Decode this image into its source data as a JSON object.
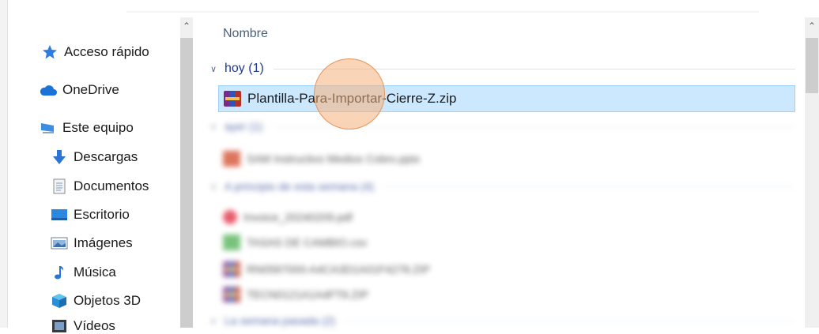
{
  "nav": {
    "items": [
      {
        "label": "Acceso rápido",
        "icon": "star-icon"
      },
      {
        "label": "OneDrive",
        "icon": "cloud-icon"
      },
      {
        "label": "Este equipo",
        "icon": "computer-icon"
      },
      {
        "label": "Descargas",
        "icon": "download-arrow-icon"
      },
      {
        "label": "Documentos",
        "icon": "document-icon"
      },
      {
        "label": "Escritorio",
        "icon": "desktop-icon"
      },
      {
        "label": "Imágenes",
        "icon": "pictures-icon"
      },
      {
        "label": "Música",
        "icon": "music-note-icon"
      },
      {
        "label": "Objetos 3D",
        "icon": "cube-3d-icon"
      },
      {
        "label": "Vídeos",
        "icon": "video-icon"
      }
    ]
  },
  "content": {
    "column_header": "Nombre",
    "groups": [
      {
        "label": "hoy (1)"
      },
      {
        "label": "ayer (1)"
      },
      {
        "label": "A principio de esta semana (4)"
      },
      {
        "label": "La semana pasada (2)"
      }
    ],
    "files": [
      {
        "name": "Plantilla-Para-Importar-Cierre-Z.zip",
        "icon": "zip-archive-icon",
        "selected": true
      },
      {
        "name": "SAM Instructivo Medios Cobro.pptx",
        "icon": "powerpoint-icon"
      },
      {
        "name": "Invoice_20240209.pdf",
        "icon": "pdf-icon"
      },
      {
        "name": "TASAS DE CAMBIO.csv",
        "icon": "csv-icon"
      },
      {
        "name": "RN0587000-A4CA3D1A01F4278.ZIP",
        "icon": "zip-archive-icon"
      },
      {
        "name": "TECN0121A1A4FT8.ZIP",
        "icon": "zip-archive-icon"
      }
    ]
  },
  "colors": {
    "selection_bg": "#cce8ff",
    "selection_border": "#99d1ff",
    "group_text": "#1e3a8a",
    "cursor_highlight": "#f4b07a"
  }
}
